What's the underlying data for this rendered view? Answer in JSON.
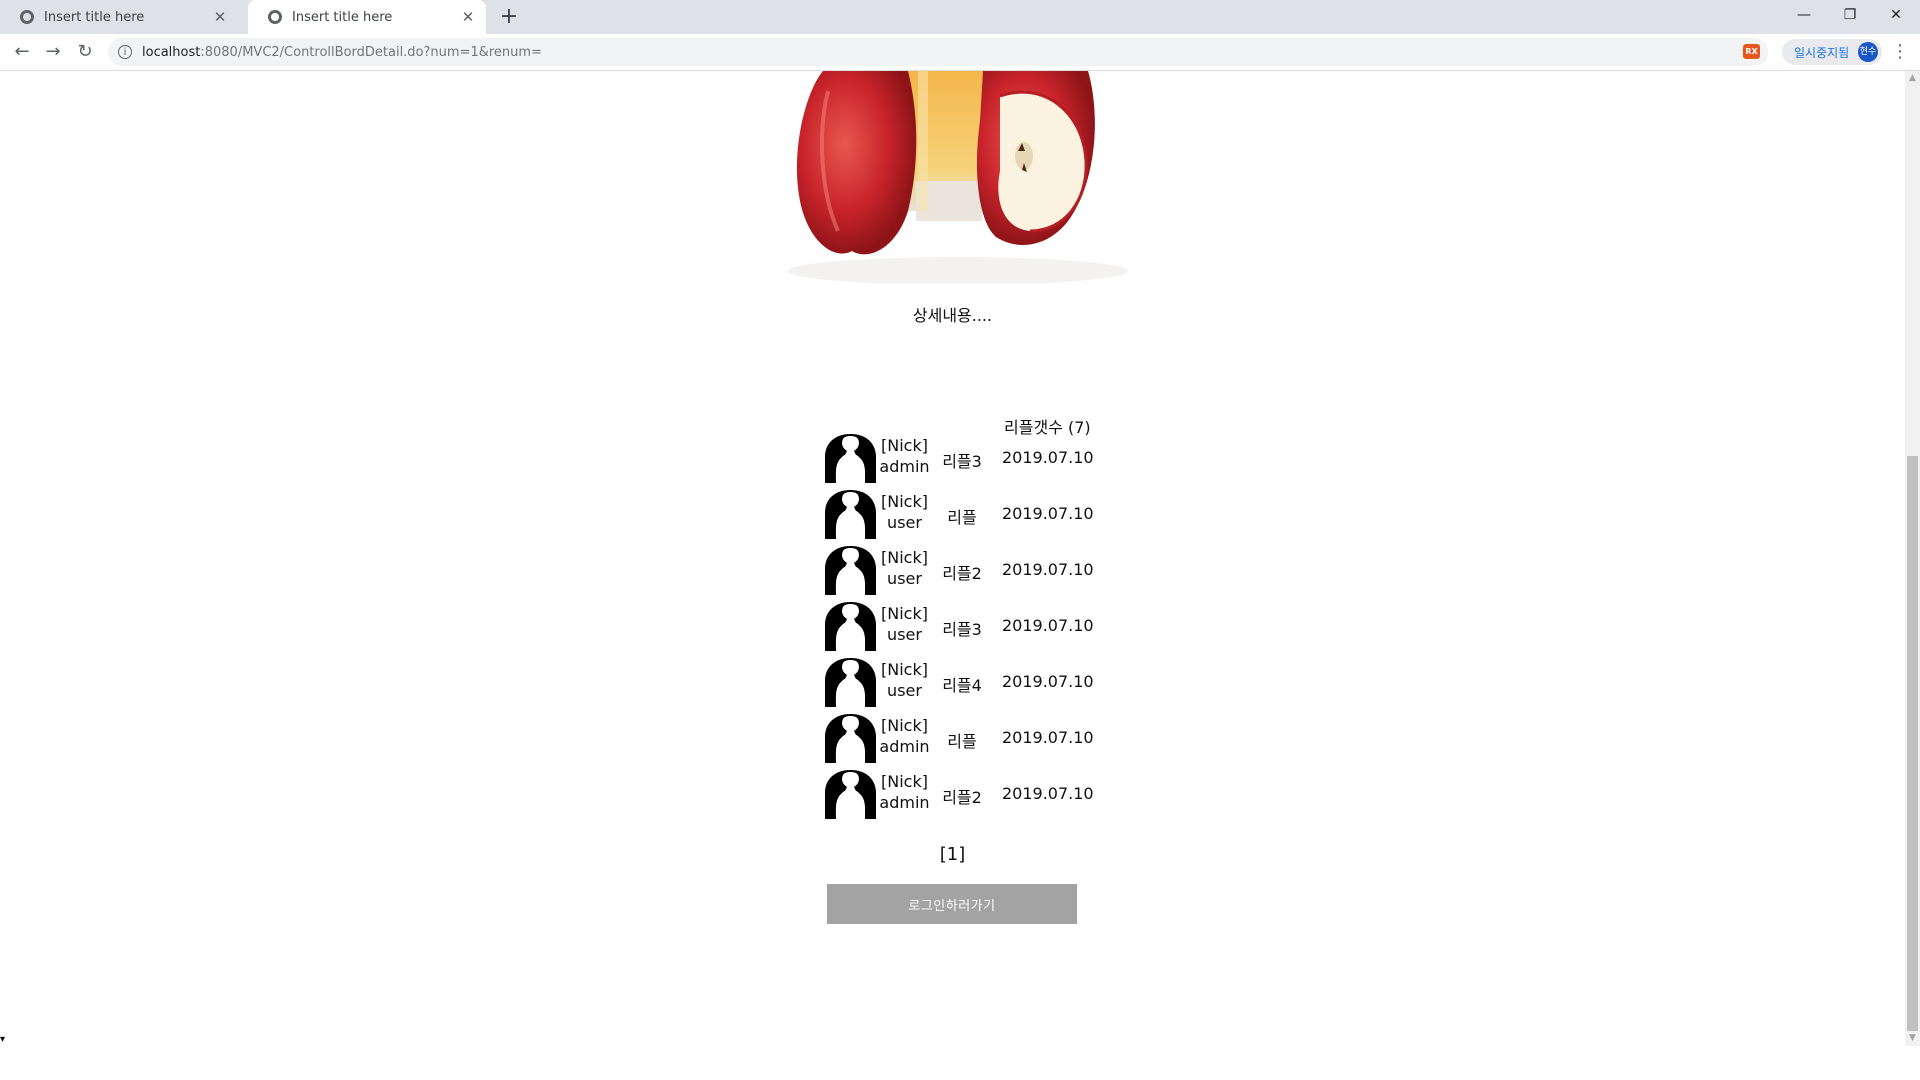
{
  "browser": {
    "tabs": [
      {
        "title": "Insert title here",
        "active": false
      },
      {
        "title": "Insert title here",
        "active": true
      }
    ],
    "new_tab_glyph": "+",
    "url_host": "localhost",
    "url_path": ":8080/MVC2/ControllBordDetail.do?num=1&renum=",
    "profile_label": "일시중지됨",
    "profile_avatar": "현수",
    "ext_label": "RX"
  },
  "page": {
    "detail_text": "상세내용....",
    "reply_count_label": "리플갯수 (7)",
    "replies": [
      {
        "nick_label": "[Nick]",
        "user": "admin",
        "content": "리플3",
        "date": "2019.07.10"
      },
      {
        "nick_label": "[Nick]",
        "user": "user",
        "content": "리플",
        "date": "2019.07.10"
      },
      {
        "nick_label": "[Nick]",
        "user": "user",
        "content": "리플2",
        "date": "2019.07.10"
      },
      {
        "nick_label": "[Nick]",
        "user": "user",
        "content": "리플3",
        "date": "2019.07.10"
      },
      {
        "nick_label": "[Nick]",
        "user": "user",
        "content": "리플4",
        "date": "2019.07.10"
      },
      {
        "nick_label": "[Nick]",
        "user": "admin",
        "content": "리플",
        "date": "2019.07.10"
      },
      {
        "nick_label": "[Nick]",
        "user": "admin",
        "content": "리플2",
        "date": "2019.07.10"
      }
    ],
    "pager": "[1]",
    "login_button": "로그인하러가기"
  },
  "icons": {
    "tab_favicon": "globe-icon",
    "avatar": "person-silhouette-icon",
    "back": "arrow-left-icon",
    "forward": "arrow-right-icon",
    "reload": "reload-icon",
    "bookmark": "star-icon"
  },
  "colors": {
    "login_button_bg": "#a3a3a3",
    "tabbar_bg": "#dee1e6"
  }
}
